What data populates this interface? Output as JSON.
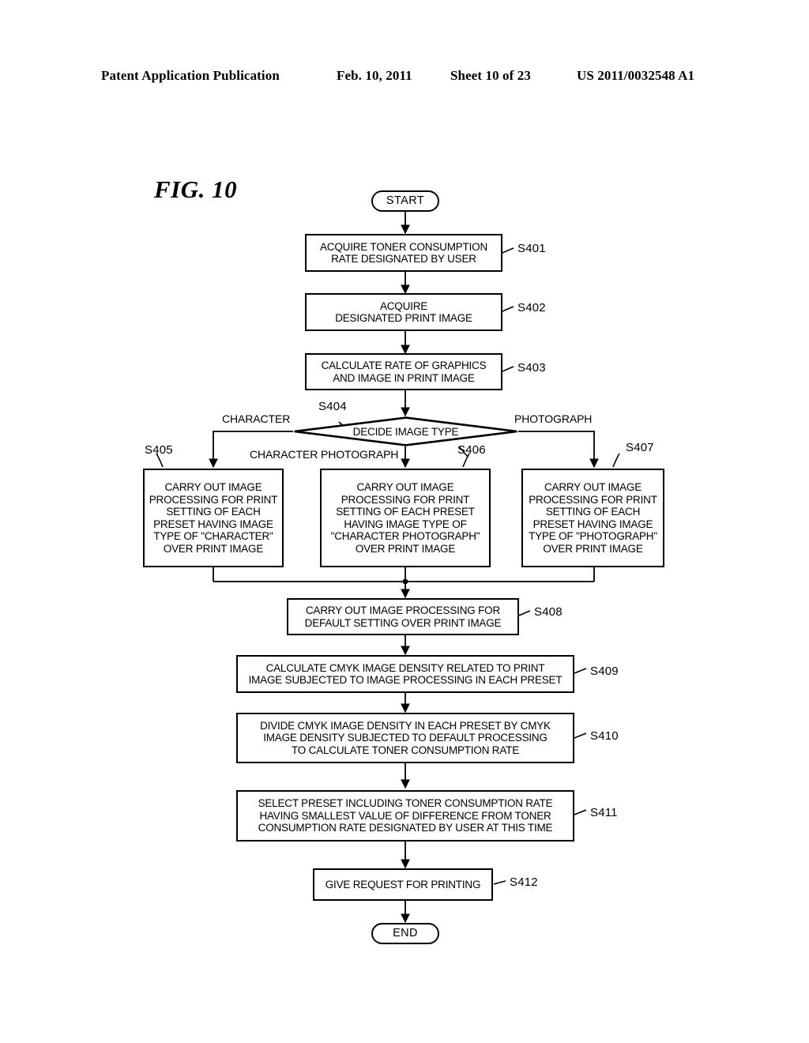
{
  "header": {
    "publication": "Patent Application Publication",
    "date": "Feb. 10, 2011",
    "sheet": "Sheet 10 of 23",
    "number": "US 2011/0032548 A1"
  },
  "figure": {
    "label": "FIG. 10"
  },
  "flowchart": {
    "start": {
      "label": "START"
    },
    "end": {
      "label": "END"
    },
    "decision": {
      "id": "S404",
      "text": "DECIDE IMAGE TYPE",
      "branches": [
        {
          "name": "character",
          "label": "CHARACTER"
        },
        {
          "name": "character-photograph",
          "label": "CHARACTER PHOTOGRAPH"
        },
        {
          "name": "photograph",
          "label": "PHOTOGRAPH"
        }
      ]
    },
    "steps": [
      {
        "id": "S401",
        "text": "ACQUIRE TONER CONSUMPTION\nRATE DESIGNATED BY USER"
      },
      {
        "id": "S402",
        "text": "ACQUIRE\nDESIGNATED PRINT IMAGE"
      },
      {
        "id": "S403",
        "text": "CALCULATE RATE OF GRAPHICS\nAND IMAGE IN PRINT IMAGE"
      },
      {
        "id": "S405",
        "text": "CARRY OUT IMAGE\nPROCESSING FOR PRINT\nSETTING OF EACH\nPRESET HAVING IMAGE\nTYPE OF \"CHARACTER\"\nOVER PRINT IMAGE"
      },
      {
        "id": "S406",
        "text": "CARRY OUT IMAGE\nPROCESSING FOR PRINT\nSETTING OF EACH PRESET\nHAVING IMAGE TYPE OF\n\"CHARACTER PHOTOGRAPH\"\nOVER PRINT IMAGE"
      },
      {
        "id": "S407",
        "text": "CARRY OUT IMAGE\nPROCESSING FOR PRINT\nSETTING OF EACH\nPRESET HAVING IMAGE\nTYPE OF \"PHOTOGRAPH\"\nOVER PRINT IMAGE"
      },
      {
        "id": "S408",
        "text": "CARRY OUT IMAGE PROCESSING FOR\nDEFAULT SETTING OVER PRINT IMAGE"
      },
      {
        "id": "S409",
        "text": "CALCULATE CMYK IMAGE DENSITY RELATED TO PRINT\nIMAGE SUBJECTED TO IMAGE PROCESSING IN EACH PRESET"
      },
      {
        "id": "S410",
        "text": "DIVIDE CMYK IMAGE DENSITY IN EACH PRESET BY CMYK\nIMAGE DENSITY SUBJECTED TO DEFAULT PROCESSING\nTO CALCULATE TONER CONSUMPTION RATE"
      },
      {
        "id": "S411",
        "text": "SELECT PRESET INCLUDING TONER CONSUMPTION RATE\nHAVING SMALLEST VALUE OF DIFFERENCE FROM TONER\nCONSUMPTION RATE DESIGNATED BY USER AT THIS TIME"
      },
      {
        "id": "S412",
        "text": "GIVE REQUEST FOR PRINTING"
      }
    ]
  },
  "colors": {
    "ink": "#000000",
    "paper": "#ffffff"
  }
}
